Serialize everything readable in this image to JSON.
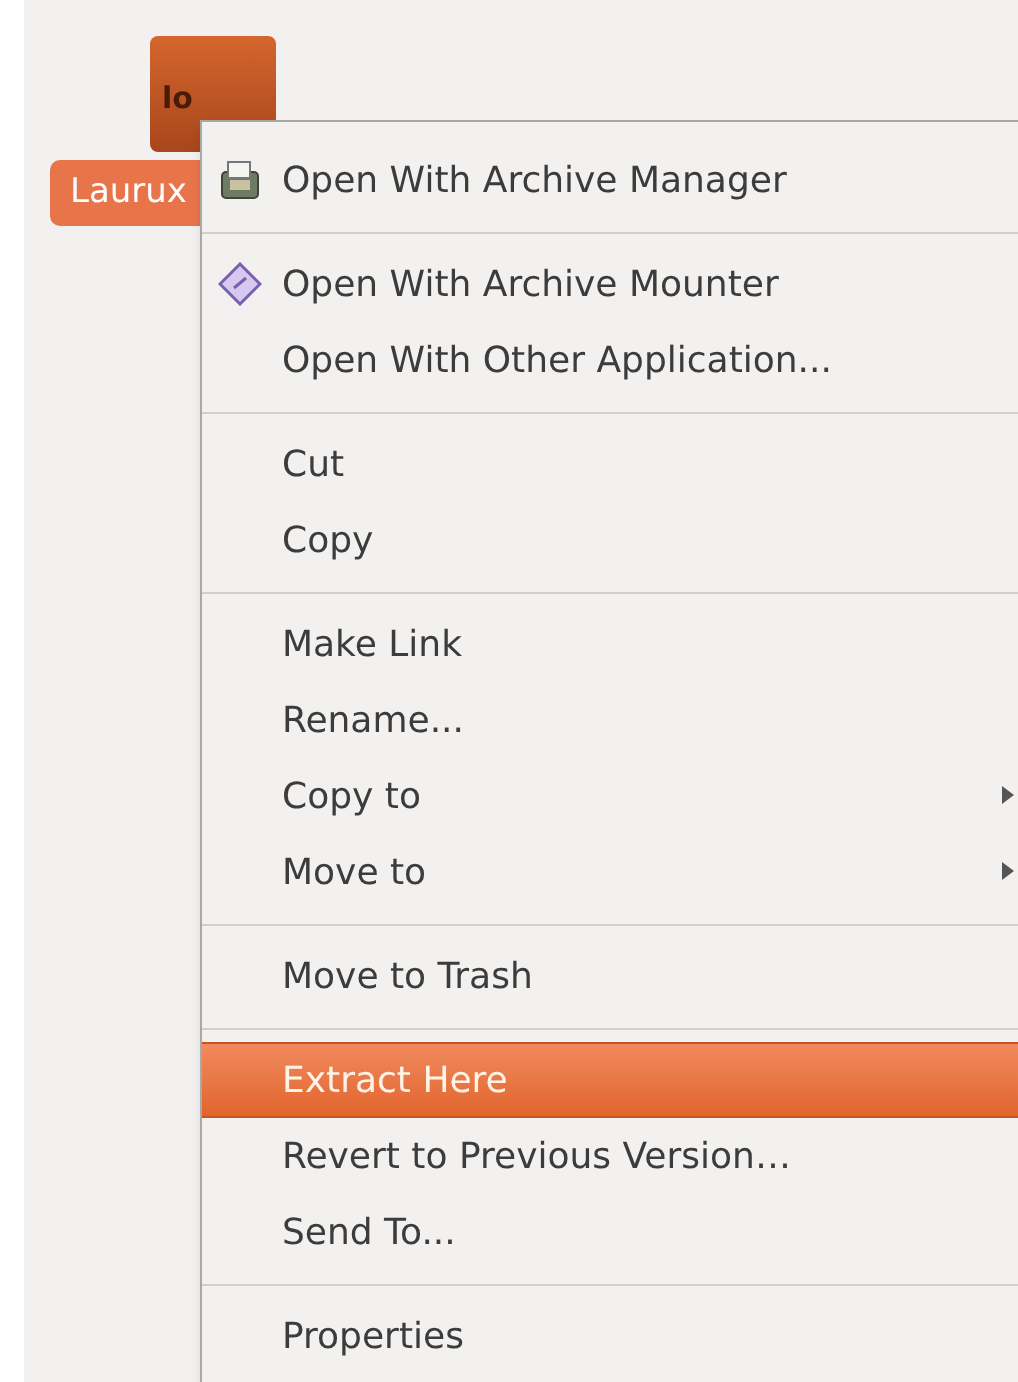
{
  "desktop_icon": {
    "box_text": "lo",
    "label": "Laurux",
    "selected": true
  },
  "menu": {
    "sections": [
      [
        {
          "label": "Open With Archive Manager",
          "kind": "icon",
          "submenu": false,
          "selected": false
        }
      ],
      [
        {
          "label": "Open With Archive Mounter",
          "kind": "icon",
          "submenu": false,
          "selected": false
        },
        {
          "label": "Open With Other Application...",
          "submenu": false,
          "selected": false
        }
      ],
      [
        {
          "label": "Cut",
          "submenu": false,
          "selected": false
        },
        {
          "label": "Copy",
          "submenu": false,
          "selected": false
        }
      ],
      [
        {
          "label": "Make Link",
          "submenu": false,
          "selected": false
        },
        {
          "label": "Rename...",
          "submenu": false,
          "selected": false
        },
        {
          "label": "Copy to",
          "submenu": true,
          "selected": false
        },
        {
          "label": "Move to",
          "submenu": true,
          "selected": false
        }
      ],
      [
        {
          "label": "Move to Trash",
          "submenu": false,
          "selected": false
        }
      ],
      [
        {
          "label": "Extract Here",
          "submenu": false,
          "selected": true
        },
        {
          "label": "Revert to Previous Version…",
          "submenu": false,
          "selected": false
        },
        {
          "label": "Send To...",
          "submenu": false,
          "selected": false
        }
      ],
      [
        {
          "label": "Properties",
          "submenu": false,
          "selected": false
        }
      ]
    ]
  }
}
